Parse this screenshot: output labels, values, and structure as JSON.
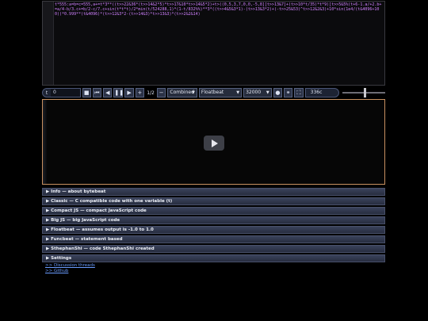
{
  "editor": {
    "code": "t*555:a=b=c=555,a+=t*3**((t>>22&36*(t>>14&2*5)*t>>17&10*t>>14&5*2)+t>((0,5,3,7,0,0,-5,8][t>>13&7]+(t>>10*t/35)*t*9)[t>>5&5%(t+6-1.a/+2.b+=a/4-b/3.c+=b/2-c/7.c+sin(t*t*t)/2*min(t/524288,1)*(1-t/832%%)**3*((t>>4&5&3*1)-(t>>13&3*2)+(-t>>25&53)^t>>12&2&3)+10*sin(1e4/(t&4096+100))*0.999**(t&4096)*(t>>12&3*2-(t>>14&3)*t>>13&3)*(t>>2&2&14)"
  },
  "controls": {
    "t_label": "t",
    "t_value": "0",
    "stop_icon": "stop-icon",
    "restart_icon": "skip-back-icon",
    "rewind_icon": "rewind-icon",
    "pause_icon": "pause-icon",
    "forward_icon": "forward-icon",
    "plus_icon": "plus-icon",
    "divisor": "1/2",
    "minus_icon": "minus-icon",
    "mode": "Combined",
    "beat_type": "Floatbeat",
    "sample_rate": "32000",
    "record_icon": "record-icon",
    "link_icon": "link-icon",
    "fullscreen_icon": "fullscreen-icon",
    "rate_display": "336c",
    "volume": 0.5
  },
  "sections": [
    {
      "title": "Info — about bytebeat"
    },
    {
      "title": "Classic — C compatible code with one variable (t)"
    },
    {
      "title": "Compact JS — compact JavaScript code"
    },
    {
      "title": "Big JS — big JavaScript code"
    },
    {
      "title": "Floatbeat — assumes output is -1.0 to 1.0"
    },
    {
      "title": "Funcbeat — statement based"
    },
    {
      "title": "SthephanShi — code SthephanShi created"
    },
    {
      "title": "Settings"
    }
  ],
  "links": {
    "discussion": ">> Discussion threads",
    "github": ">> Github"
  }
}
